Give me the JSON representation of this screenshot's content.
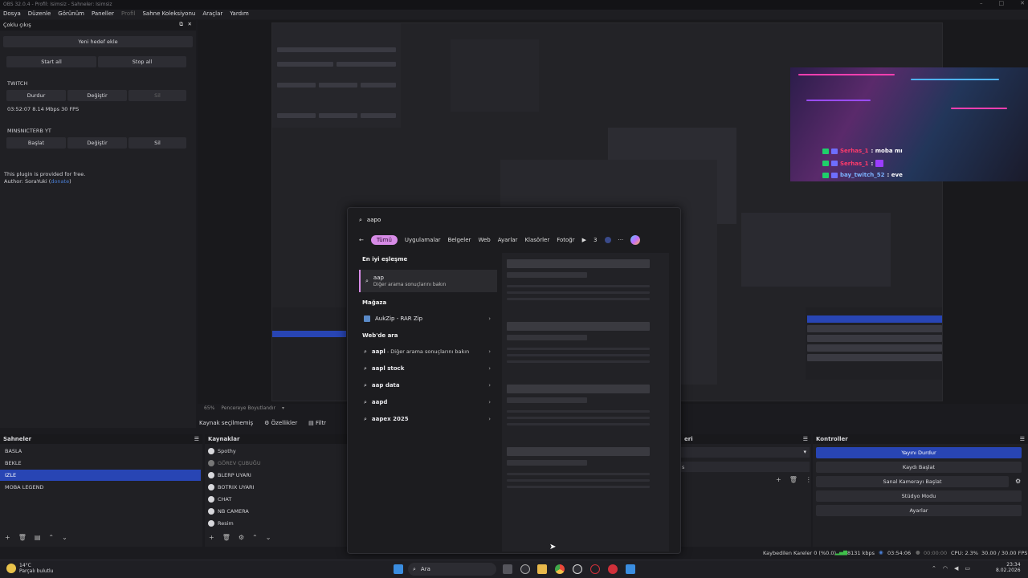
{
  "window": {
    "title": "OBS 32.0.4 - Profil: Isimsiz - Sahneler: Isimsiz"
  },
  "menu": [
    "Dosya",
    "Düzenle",
    "Görünüm",
    "Paneller",
    "Profil",
    "Sahne Koleksiyonu",
    "Araçlar",
    "Yardım"
  ],
  "multistream": {
    "dock_title": "Çoklu çıkış",
    "new_target": "Yeni hedef ekle",
    "start_all": "Start all",
    "stop_all": "Stop all",
    "targets": [
      {
        "name": "TWITCH",
        "primary": "Durdur",
        "edit": "Değiştir",
        "remove": "Sil",
        "status": "03:52:07  8.14 Mbps  30 FPS"
      },
      {
        "name": "MINSNICTERB YT",
        "primary": "Başlat",
        "edit": "Değiştir",
        "remove": "Sil",
        "status": ""
      }
    ],
    "footer_line1": "This plugin is provided for free.",
    "footer_line2_prefix": "Author: SoraYuki (",
    "footer_link": "donate",
    "footer_line2_suffix": ")"
  },
  "chat": [
    {
      "user": "Serhas_1",
      "msg": ": moba mı",
      "color": "#ff3b6b"
    },
    {
      "user": "Serhas_1",
      "msg": ":",
      "color": "#ff3b6b"
    },
    {
      "user": "bay_twitch_52",
      "msg": ": eve",
      "color": "#7db3ff"
    }
  ],
  "preview_status": {
    "zoom": "65%",
    "fit": "Pencereye Boyutlandır"
  },
  "props_bar": {
    "no_source": "Kaynak seçilmemiş",
    "properties": "Özellikler",
    "filters": "Filtr"
  },
  "scenes": {
    "title": "Sahneler",
    "items": [
      "BASLA",
      "BEKLE",
      "IZLE",
      "MOBA LEGEND"
    ],
    "selected": 2
  },
  "sources": {
    "title": "Kaynaklar",
    "items": [
      {
        "name": "Spothy",
        "dim": false
      },
      {
        "name": "GÖREV ÇUBUĞU",
        "dim": true
      },
      {
        "name": "BLERP UYARI",
        "dim": false
      },
      {
        "name": "BOTRIX UYARI",
        "dim": false
      },
      {
        "name": "CHAT",
        "dim": false
      },
      {
        "name": "NB CAMERA",
        "dim": false
      },
      {
        "name": "Resim",
        "dim": false
      }
    ]
  },
  "mixer": {
    "title": "eri",
    "value": "s"
  },
  "controls": {
    "title": "Kontroller",
    "buttons": [
      "Yayını Durdur",
      "Kaydı Başlat",
      "Sanal Kamerayı Başlat",
      "Stüdyo Modu",
      "Ayarlar"
    ]
  },
  "statusbar": {
    "dropped": "Kaybedilen Kareler 0 (%0.0)",
    "bitrate": "8131 kbps",
    "stream_time": "03:54:06",
    "rec_time": "00:00:00",
    "cpu": "CPU: 2.3%",
    "fps": "30.00 / 30.00 FPS"
  },
  "search": {
    "query": "aapo",
    "filters": [
      "Tümü",
      "Uygulamalar",
      "Belgeler",
      "Web",
      "Ayarlar",
      "Klasörler",
      "Fotoğr"
    ],
    "count": "3",
    "best_match_title": "En iyi eşleşme",
    "best_match": {
      "title": "aap",
      "subtitle": "Diğer arama sonuçlarını bakın"
    },
    "store_title": "Mağaza",
    "store_item": "AukZip - RAR Zip",
    "web_title": "Web'de ara",
    "web_items": [
      {
        "bold": "aapl",
        "rest": " - Diğer arama sonuçlarını bakın"
      },
      {
        "bold": "aapl stock",
        "rest": ""
      },
      {
        "bold": "aap data",
        "rest": ""
      },
      {
        "bold": "aapd",
        "rest": ""
      },
      {
        "bold": "aapex 2025",
        "rest": ""
      }
    ]
  },
  "taskbar": {
    "weather_temp": "14°C",
    "weather_desc": "Parçalı bulutlu",
    "search_placeholder": "Ara",
    "time": "23:34",
    "date": "8.02.2026"
  },
  "colors": {
    "accent": "#2845b4",
    "search_accent": "#d78be6"
  }
}
